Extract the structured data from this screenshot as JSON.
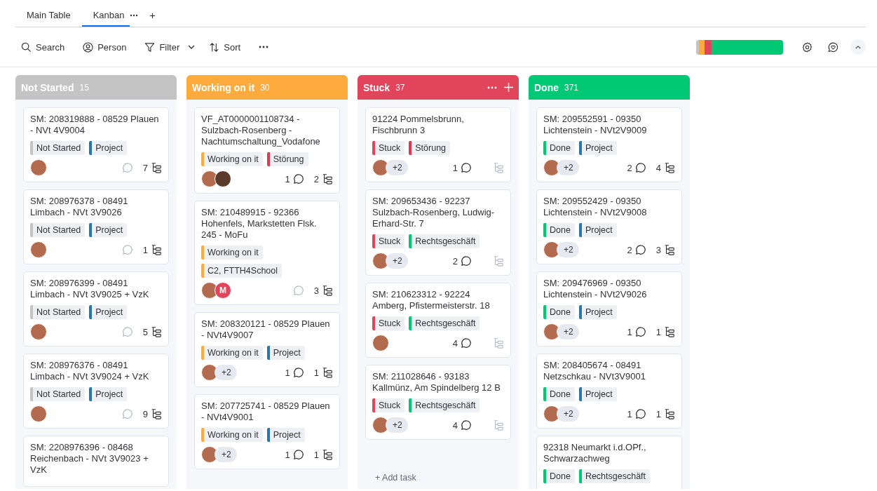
{
  "view_tabs": [
    {
      "label": "Main Table",
      "selected": false
    },
    {
      "label": "Kanban",
      "selected": true
    }
  ],
  "toolbar": {
    "items": [
      {
        "kind": "search",
        "label": "Search"
      },
      {
        "kind": "person",
        "label": "Person"
      },
      {
        "kind": "filter",
        "label": "Filter"
      },
      {
        "kind": "sort",
        "label": "Sort"
      }
    ]
  },
  "progress": [
    {
      "color": "#c4c4c4",
      "level": 0.033
    },
    {
      "color": "#fdab3d",
      "level": 0.066
    },
    {
      "color": "#e2445c",
      "level": 0.082
    },
    {
      "color": "#00c875",
      "level": 0.819
    }
  ],
  "columns": [
    {
      "title": "Not Started",
      "count": "15",
      "color": "#c4c4c4",
      "show_actions": false,
      "cards": [
        {
          "title": "SM: 208319888 - 08529 Plauen - NVt 4V9004",
          "tags": [
            [
              {
                "label": "Not Started",
                "color": "#c4c4c4"
              },
              {
                "label": "Project",
                "color": "#2b76a8"
              }
            ]
          ],
          "avatars": [
            {
              "kind": "photo"
            }
          ],
          "subitems": "7"
        },
        {
          "title": "SM: 208976378 - 08491 Limbach - NVt 3V9026",
          "tags": [
            [
              {
                "label": "Not Started",
                "color": "#c4c4c4"
              },
              {
                "label": "Project",
                "color": "#2b76a8"
              }
            ]
          ],
          "avatars": [
            {
              "kind": "photo"
            }
          ],
          "subitems": "1"
        },
        {
          "title": "SM: 208976399 - 08491 Limbach - NVt 3V9025 + VzK",
          "tags": [
            [
              {
                "label": "Not Started",
                "color": "#c4c4c4"
              },
              {
                "label": "Project",
                "color": "#2b76a8"
              }
            ]
          ],
          "avatars": [
            {
              "kind": "photo"
            }
          ],
          "subitems": "5"
        },
        {
          "title": "SM: 208976376 - 08491 Limbach - NVt 3V9024 + VzK",
          "tags": [
            [
              {
                "label": "Not Started",
                "color": "#c4c4c4"
              },
              {
                "label": "Project",
                "color": "#2b76a8"
              }
            ]
          ],
          "avatars": [
            {
              "kind": "photo"
            }
          ],
          "subitems": "9"
        },
        {
          "title": "SM: 2208976396 - 08468 Reichenbach - NVt 3V9023 + VzK"
        }
      ]
    },
    {
      "title": "Working on it",
      "count": "30",
      "color": "#fdab3d",
      "show_actions": false,
      "cards": [
        {
          "title": "VF_AT0000001108734 - Sulzbach-Rosenberg - Nachtumschaltung_Vodafone",
          "tags": [
            [
              {
                "label": "Working on it",
                "color": "#fdab3d"
              },
              {
                "label": "Störung",
                "color": "#d83a52"
              }
            ]
          ],
          "avatars": [
            {
              "kind": "photo"
            },
            {
              "kind": "photo-dark"
            }
          ],
          "comments": "1",
          "subitems": "2"
        },
        {
          "title": "SM: 210489915 - 92366 Hohenfels, Markstetten Flsk. 245 - MoFu",
          "tags": [
            [
              {
                "label": "Working on it",
                "color": "#fdab3d"
              }
            ],
            [
              {
                "label": "C2, FTTH4School",
                "color": "#fdab3d"
              }
            ]
          ],
          "avatars": [
            {
              "kind": "photo"
            },
            {
              "kind": "letter",
              "letter": "M",
              "color": "#e2445c"
            }
          ],
          "subitems": "3"
        },
        {
          "title": "SM: 208320121 - 08529 Plauen - NVt4V9007",
          "tags": [
            [
              {
                "label": "Working on it",
                "color": "#fdab3d"
              },
              {
                "label": "Project",
                "color": "#2b76a8"
              }
            ]
          ],
          "avatars": [
            {
              "kind": "photo"
            },
            {
              "kind": "more",
              "label": "+2"
            }
          ],
          "comments": "1",
          "subitems": "1"
        },
        {
          "title": "SM: 207725741 - 08529 Plauen - NVt4V9001",
          "tags": [
            [
              {
                "label": "Working on it",
                "color": "#fdab3d"
              },
              {
                "label": "Project",
                "color": "#2b76a8"
              }
            ]
          ],
          "avatars": [
            {
              "kind": "photo"
            },
            {
              "kind": "more",
              "label": "+2"
            }
          ],
          "comments": "1",
          "subitems": "1"
        }
      ]
    },
    {
      "title": "Stuck",
      "count": "37",
      "color": "#e2445c",
      "show_actions": true,
      "add_task": "+ Add task",
      "cards": [
        {
          "title": "91224 Pommelsbrunn, Fischbrunn 3",
          "tags": [
            [
              {
                "label": "Stuck",
                "color": "#e2445c"
              },
              {
                "label": "Störung",
                "color": "#d83a52"
              }
            ]
          ],
          "avatars": [
            {
              "kind": "photo"
            },
            {
              "kind": "more",
              "label": "+2"
            }
          ],
          "comments": "1"
        },
        {
          "title": "SM: 209653436 - 92237 Sulzbach-Rosenberg, Ludwig-Erhard-Str. 7",
          "tags": [
            [
              {
                "label": "Stuck",
                "color": "#e2445c"
              },
              {
                "label": "Rechtsgeschäft",
                "color": "#00c875"
              }
            ]
          ],
          "avatars": [
            {
              "kind": "photo"
            },
            {
              "kind": "more",
              "label": "+2"
            }
          ],
          "comments": "2"
        },
        {
          "title": "SM: 210623312 - 92224 Amberg, Pfistermeisterstr. 18",
          "tags": [
            [
              {
                "label": "Stuck",
                "color": "#e2445c"
              },
              {
                "label": "Rechtsgeschäft",
                "color": "#00c875"
              }
            ]
          ],
          "avatars": [
            {
              "kind": "photo"
            }
          ],
          "comments": "4"
        },
        {
          "title": "SM: 211028646 - 93183 Kallmünz, Am Spindelberg 12 B",
          "tags": [
            [
              {
                "label": "Stuck",
                "color": "#e2445c"
              },
              {
                "label": "Rechtsgeschäft",
                "color": "#00c875"
              }
            ]
          ],
          "avatars": [
            {
              "kind": "photo"
            },
            {
              "kind": "more",
              "label": "+2"
            }
          ],
          "comments": "4"
        }
      ]
    },
    {
      "title": "Done",
      "count": "371",
      "color": "#00c875",
      "show_actions": false,
      "cards": [
        {
          "title": "SM: 209552591 - 09350 Lichtenstein - NVt2V9009",
          "tags": [
            [
              {
                "label": "Done",
                "color": "#00c875"
              },
              {
                "label": "Project",
                "color": "#2b76a8"
              }
            ]
          ],
          "avatars": [
            {
              "kind": "photo"
            },
            {
              "kind": "more",
              "label": "+2"
            }
          ],
          "comments": "2",
          "subitems": "4"
        },
        {
          "title": "SM: 209552429 - 09350 Lichtenstein - NVt2V9008",
          "tags": [
            [
              {
                "label": "Done",
                "color": "#00c875"
              },
              {
                "label": "Project",
                "color": "#2b76a8"
              }
            ]
          ],
          "avatars": [
            {
              "kind": "photo"
            },
            {
              "kind": "more",
              "label": "+2"
            }
          ],
          "comments": "2",
          "subitems": "3"
        },
        {
          "title": "SM: 209476969 - 09350 Lichtenstein - NVt2V9026",
          "tags": [
            [
              {
                "label": "Done",
                "color": "#00c875"
              },
              {
                "label": "Project",
                "color": "#2b76a8"
              }
            ]
          ],
          "avatars": [
            {
              "kind": "photo"
            },
            {
              "kind": "more",
              "label": "+2"
            }
          ],
          "comments": "1",
          "subitems": "1"
        },
        {
          "title": "SM: 208405674 - 08491 Netzschkau - NVt3V9001",
          "tags": [
            [
              {
                "label": "Done",
                "color": "#00c875"
              },
              {
                "label": "Project",
                "color": "#2b76a8"
              }
            ]
          ],
          "avatars": [
            {
              "kind": "photo"
            },
            {
              "kind": "more",
              "label": "+2"
            }
          ],
          "comments": "1",
          "subitems": "1"
        },
        {
          "title": "92318 Neumarkt i.d.OPf., Schwarzachweg",
          "tags": [
            [
              {
                "label": "Done",
                "color": "#00c875"
              },
              {
                "label": "Rechtsgeschäft",
                "color": "#00c875"
              }
            ]
          ]
        }
      ]
    }
  ]
}
